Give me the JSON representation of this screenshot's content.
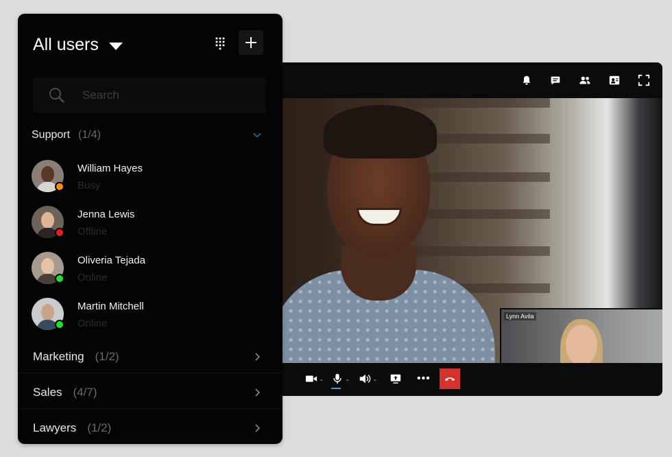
{
  "panel": {
    "title": "All users",
    "search_placeholder": "Search"
  },
  "groups": [
    {
      "name": "Support",
      "count": "(1/4)",
      "expanded": true,
      "users": [
        {
          "name": "William Hayes",
          "status": "Busy",
          "status_color": "#f58a1f"
        },
        {
          "name": "Jenna Lewis",
          "status": "Offline",
          "status_color": "#e81c1c"
        },
        {
          "name": "Oliveria Tejada",
          "status": "Online",
          "status_color": "#1fe030"
        },
        {
          "name": "Martin Mitchell",
          "status": "Online",
          "status_color": "#1fe030"
        }
      ]
    },
    {
      "name": "Marketing",
      "count": "(1/2)",
      "expanded": false
    },
    {
      "name": "Sales",
      "count": "(4/7)",
      "expanded": false
    },
    {
      "name": "Lawyers",
      "count": "(1/2)",
      "expanded": false
    }
  ],
  "video": {
    "toolbar_icons": [
      "bell-icon",
      "chat-icon",
      "participants-icon",
      "contact-card-icon",
      "fullscreen-icon"
    ],
    "pip_label": "Lynn Avila",
    "controls": [
      "camera-icon",
      "microphone-icon",
      "speaker-icon",
      "screen-share-icon",
      "more-icon",
      "hangup-icon"
    ],
    "hangup_color": "#d7332e"
  }
}
